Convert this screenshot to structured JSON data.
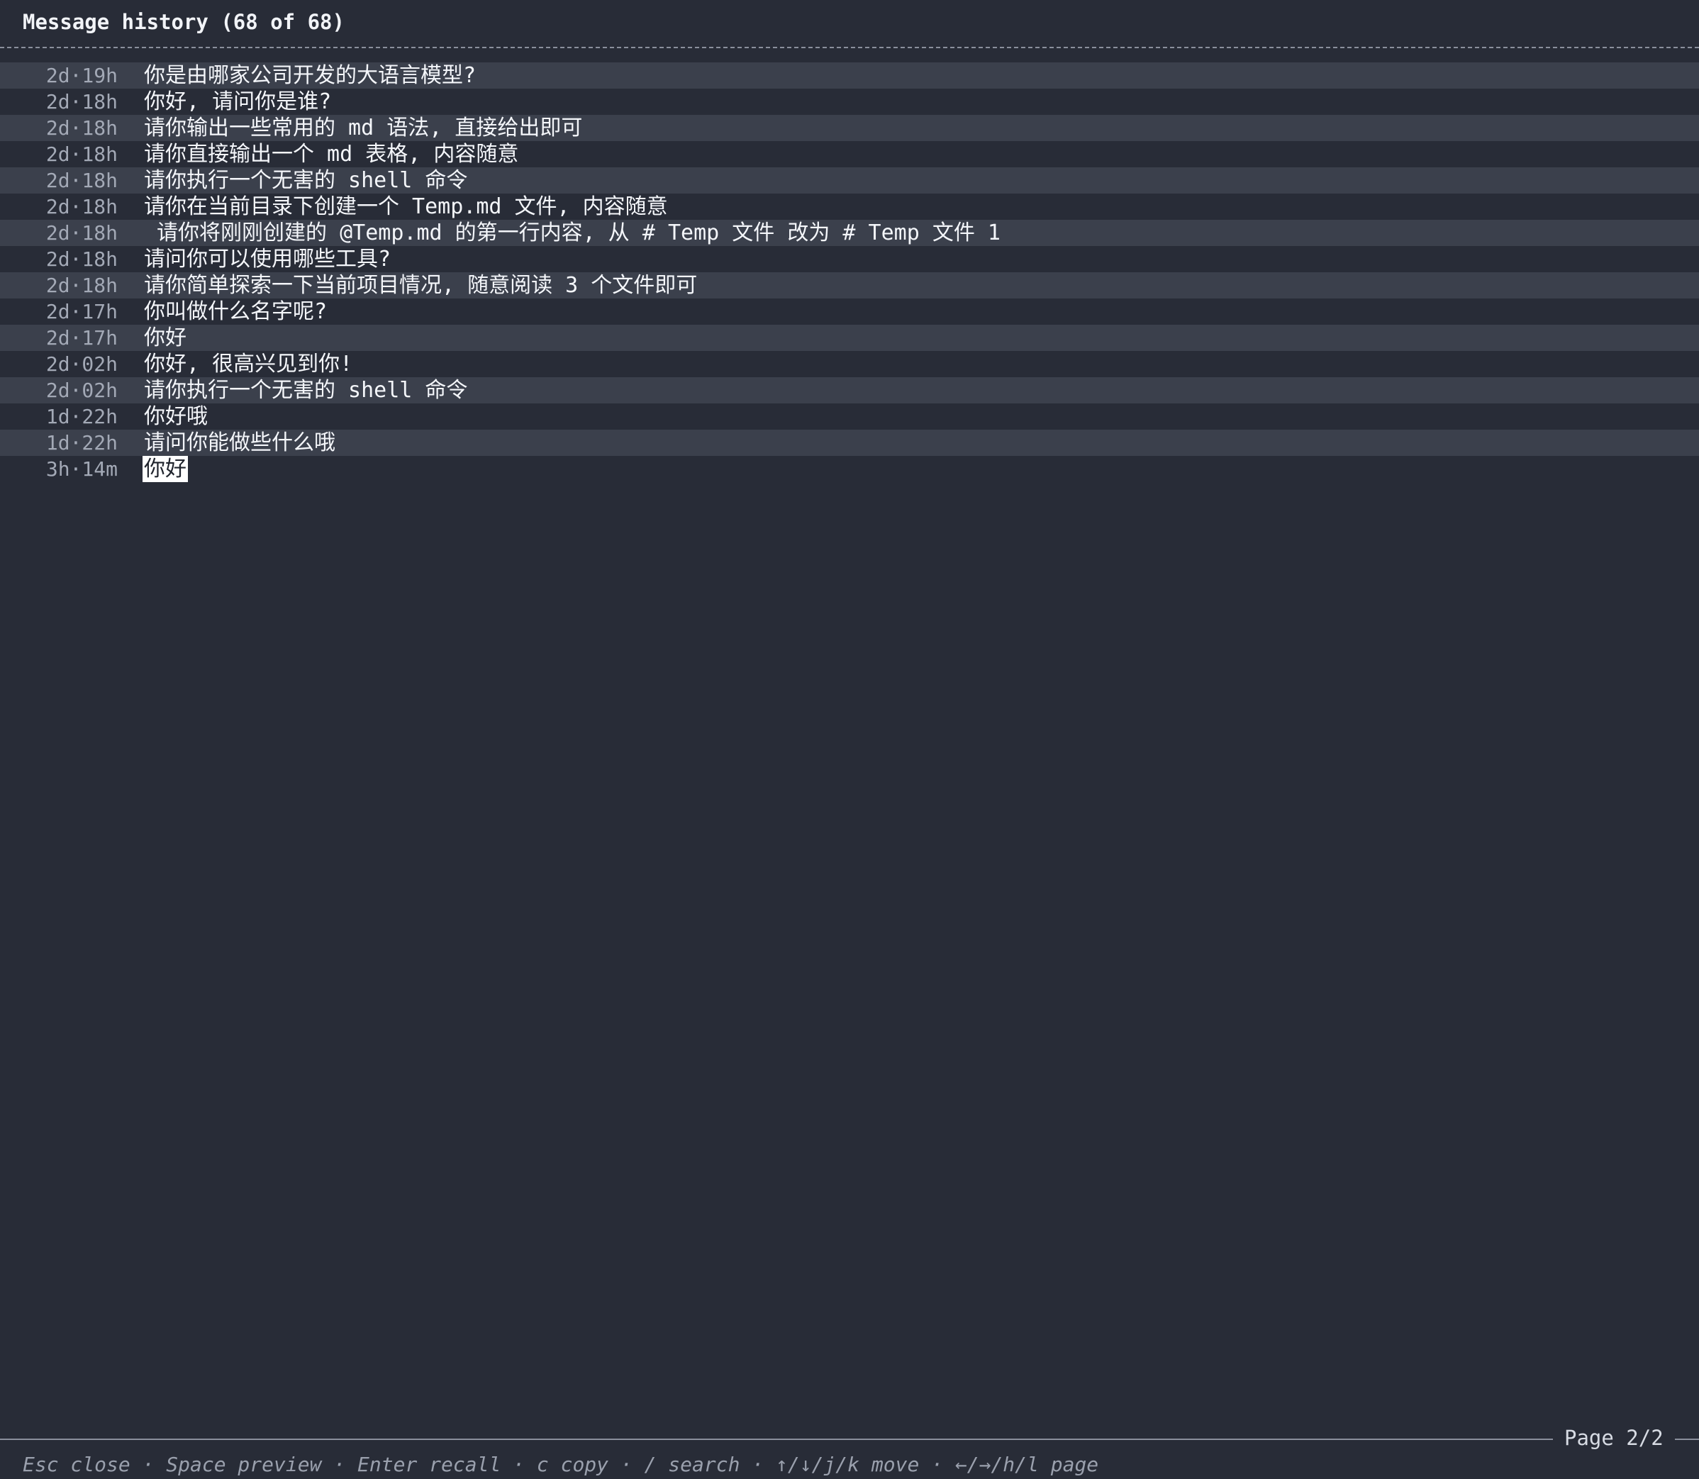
{
  "header": {
    "title": "Message history (68 of 68)"
  },
  "messages": [
    {
      "time": "2d·19h",
      "text": "你是由哪家公司开发的大语言模型?"
    },
    {
      "time": "2d·18h",
      "text": "你好, 请问你是谁?"
    },
    {
      "time": "2d·18h",
      "text": "请你输出一些常用的 md 语法, 直接给出即可"
    },
    {
      "time": "2d·18h",
      "text": "请你直接输出一个 md 表格, 内容随意"
    },
    {
      "time": "2d·18h",
      "text": "请你执行一个无害的 shell 命令"
    },
    {
      "time": "2d·18h",
      "text": "请你在当前目录下创建一个 Temp.md 文件, 内容随意"
    },
    {
      "time": "2d·18h",
      "text": " 请你将刚刚创建的 @Temp.md 的第一行内容, 从 # Temp 文件 改为 # Temp 文件 1"
    },
    {
      "time": "2d·18h",
      "text": "请问你可以使用哪些工具?"
    },
    {
      "time": "2d·18h",
      "text": "请你简单探索一下当前项目情况, 随意阅读 3 个文件即可"
    },
    {
      "time": "2d·17h",
      "text": "你叫做什么名字呢?"
    },
    {
      "time": "2d·17h",
      "text": "你好"
    },
    {
      "time": "2d·02h",
      "text": "你好, 很高兴见到你!"
    },
    {
      "time": "2d·02h",
      "text": "请你执行一个无害的 shell 命令"
    },
    {
      "time": "1d·22h",
      "text": "你好哦"
    },
    {
      "time": "1d·22h",
      "text": "请问你能做些什么哦"
    },
    {
      "time": "3h·14m",
      "text": "你好"
    }
  ],
  "selected_index": 15,
  "pagination": {
    "label": "Page 2/2"
  },
  "footer": {
    "hints": "Esc close · Space preview · Enter recall · c copy · / search · ↑/↓/j/k move · ←/→/h/l page"
  },
  "colors": {
    "background": "#282c37",
    "stripe": "#3b404c",
    "selected_bg": "#ffffff"
  }
}
